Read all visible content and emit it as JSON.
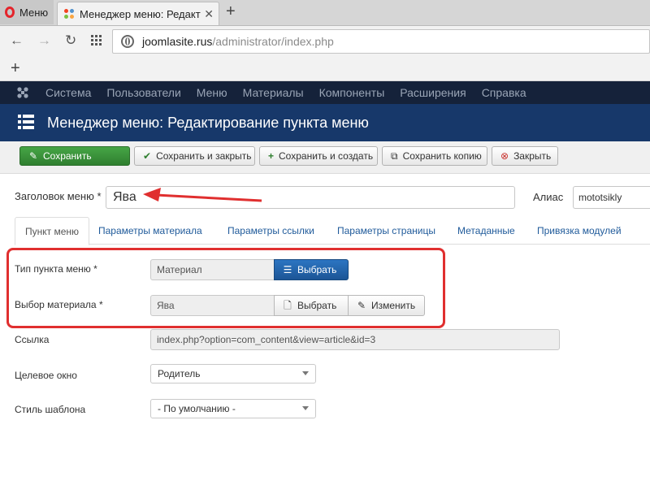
{
  "browser": {
    "menu_label": "Меню",
    "tab_title": "Менеджер меню: Редакт",
    "new_tab": "+",
    "url_host": "joomlasite.rus",
    "url_path": "/administrator/index.php",
    "bookmark_add": "+"
  },
  "topnav": {
    "items": [
      "Система",
      "Пользователи",
      "Меню",
      "Материалы",
      "Компоненты",
      "Расширения",
      "Справка"
    ]
  },
  "page_title": "Менеджер меню: Редактирование пункта меню",
  "toolbar": {
    "save": "Сохранить",
    "save_close": "Сохранить и закрыть",
    "save_new": "Сохранить и создать",
    "save_copy": "Сохранить копию",
    "close": "Закрыть"
  },
  "form": {
    "title_label": "Заголовок меню *",
    "title_value": "Ява",
    "alias_label": "Алиас",
    "alias_value": "mototsikly",
    "tabs": [
      "Пункт меню",
      "Параметры материала",
      "Параметры ссылки",
      "Параметры страницы",
      "Метаданные",
      "Привязка модулей"
    ],
    "type_label": "Тип пункта меню *",
    "type_value": "Материал",
    "type_button": "Выбрать",
    "article_label": "Выбор материала *",
    "article_value": "Ява",
    "article_select_button": "Выбрать",
    "article_edit_button": "Изменить",
    "link_label": "Ссылка",
    "link_value": "index.php?option=com_content&view=article&id=3",
    "target_label": "Целевое окно",
    "target_value": "Родитель",
    "template_label": "Стиль шаблона",
    "template_value": "- По умолчанию -"
  },
  "colors": {
    "topnav_bg": "#15223a",
    "title_bg": "#17386a",
    "save_green": "#3a913a",
    "primary_blue": "#2a6ab0",
    "annotation_red": "#e02f2f"
  }
}
